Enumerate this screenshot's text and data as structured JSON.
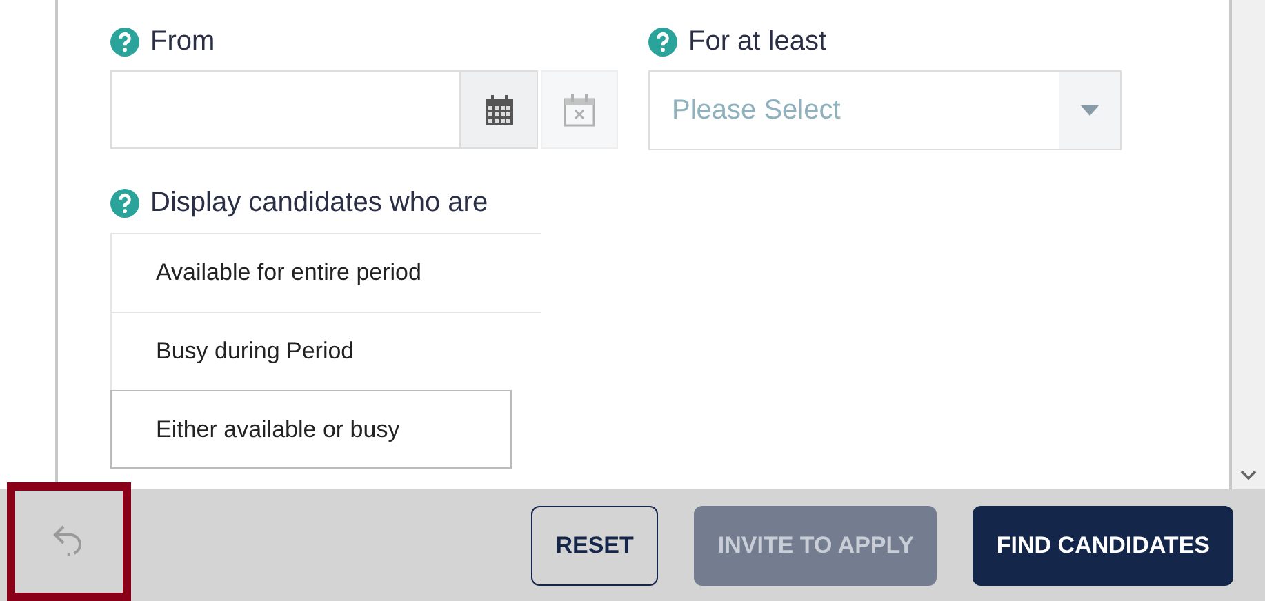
{
  "from_field": {
    "label": "From",
    "clear_disabled": true
  },
  "for_at_least": {
    "label": "For at least",
    "placeholder": "Please Select"
  },
  "display": {
    "label": "Display candidates who are",
    "options": [
      {
        "label": "Available for entire period",
        "selected": false
      },
      {
        "label": "Busy during Period",
        "selected": false
      },
      {
        "label": "Either available or busy",
        "selected": true
      }
    ]
  },
  "footer": {
    "undo_disabled": true,
    "buttons": [
      {
        "label": "RESET",
        "kind": "outline",
        "disabled": false
      },
      {
        "label": "INVITE TO APPLY",
        "kind": "primary",
        "disabled": true
      },
      {
        "label": "FIND CANDIDATES",
        "kind": "primary",
        "disabled": false
      }
    ]
  }
}
